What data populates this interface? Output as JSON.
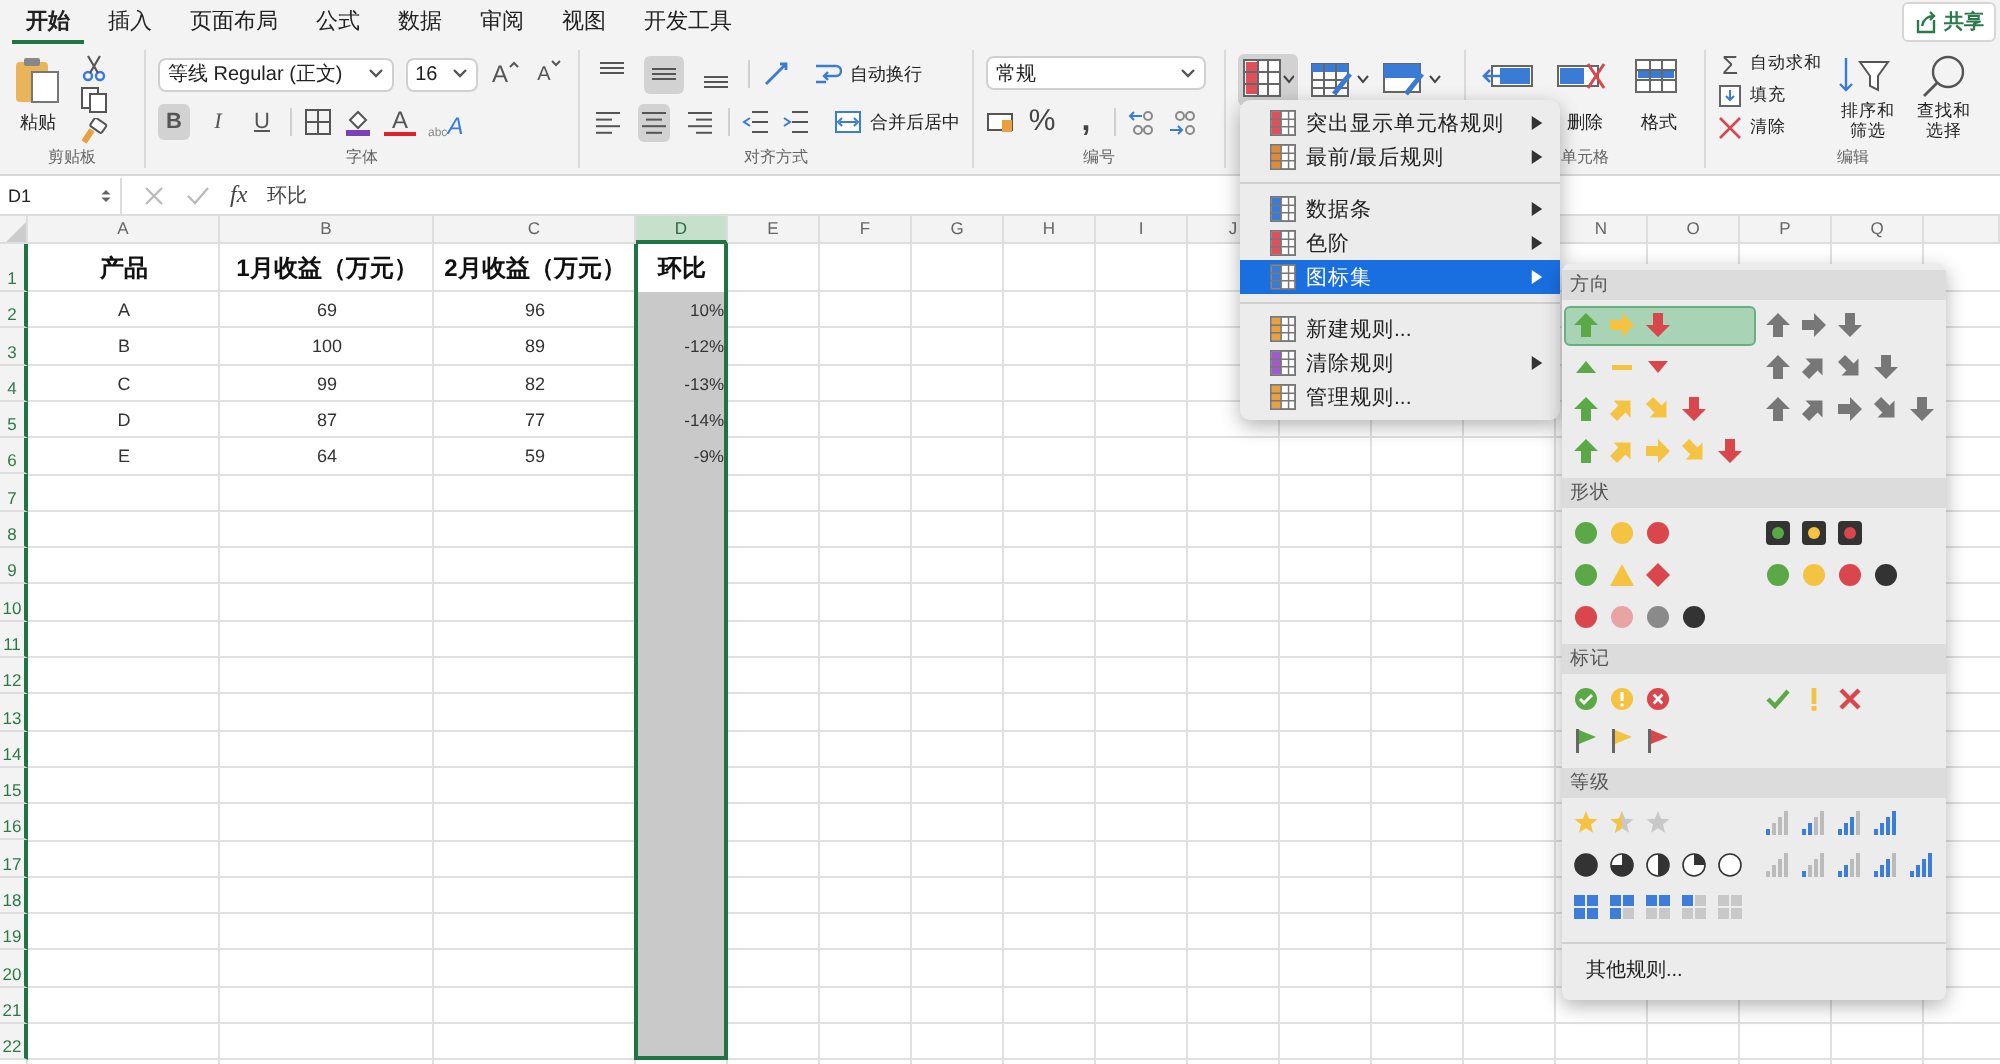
{
  "tabs": [
    {
      "label": "开始",
      "selected": true
    },
    {
      "label": "插入",
      "selected": false
    },
    {
      "label": "页面布局",
      "selected": false
    },
    {
      "label": "公式",
      "selected": false
    },
    {
      "label": "数据",
      "selected": false
    },
    {
      "label": "审阅",
      "selected": false
    },
    {
      "label": "视图",
      "selected": false
    },
    {
      "label": "开发工具",
      "selected": false
    }
  ],
  "share_button": "共享",
  "ribbon": {
    "clipboard": {
      "paste": "粘贴",
      "label": "剪贴板"
    },
    "font": {
      "name": "等线 Regular (正文)",
      "size": "16",
      "grow": "A",
      "shrink": "A",
      "styles": [
        {
          "label": "B",
          "selected": true
        },
        {
          "label": "I",
          "selected": false
        },
        {
          "label": "U",
          "selected": false
        }
      ],
      "font_color": "A",
      "effects_small": "abc",
      "effects_big": "A",
      "label": "字体"
    },
    "alignment": {
      "vertical": [
        {
          "kind": "top",
          "selected": false
        },
        {
          "kind": "middle",
          "selected": true
        },
        {
          "kind": "bottom",
          "selected": false
        }
      ],
      "horizontal": [
        {
          "kind": "left",
          "selected": false
        },
        {
          "kind": "center",
          "selected": true
        },
        {
          "kind": "right",
          "selected": false
        }
      ],
      "wrap": "自动换行",
      "merge": "合并后居中",
      "label": "对齐方式"
    },
    "number": {
      "format": "常规",
      "percent": "%",
      "comma": ",",
      "label": "编号"
    },
    "styles": {
      "conditional_expanded": true
    },
    "cells": {
      "items": [
        {
          "kind": "insert"
        },
        {
          "kind": "delete",
          "label": "删除"
        },
        {
          "kind": "format",
          "label": "格式"
        }
      ],
      "label": "单元格"
    },
    "editing": {
      "autosum_symbol": "Σ",
      "autosum": "自动求和",
      "fill": "填充",
      "clear": "清除",
      "sort": "排序和筛选",
      "find": "查找和选择",
      "label": "编辑"
    }
  },
  "formula_bar": {
    "name_box": "D1",
    "fx": "fx",
    "formula": "环比"
  },
  "sheet": {
    "columns": [
      {
        "label": "A",
        "selected": false
      },
      {
        "label": "B",
        "selected": false
      },
      {
        "label": "C",
        "selected": false
      },
      {
        "label": "D",
        "selected": true
      },
      {
        "label": "E",
        "selected": false
      },
      {
        "label": "F",
        "selected": false
      },
      {
        "label": "G",
        "selected": false
      },
      {
        "label": "H",
        "selected": false
      },
      {
        "label": "I",
        "selected": false
      },
      {
        "label": "J",
        "selected": false
      }
    ],
    "columns_right": [
      {
        "label": "N",
        "selected": false
      },
      {
        "label": "O",
        "selected": false
      },
      {
        "label": "P",
        "selected": false
      },
      {
        "label": "Q",
        "selected": false
      }
    ],
    "row_numbers": [
      "1",
      "2",
      "3",
      "4",
      "5",
      "6",
      "7",
      "8",
      "9",
      "10",
      "11",
      "12",
      "13",
      "14",
      "15",
      "16",
      "17",
      "18",
      "19",
      "20",
      "21",
      "22"
    ],
    "cells": [
      [
        "产品",
        "1月收益（万元）",
        "2月收益（万元）",
        "环比"
      ],
      [
        "A",
        "69",
        "96",
        "10%"
      ],
      [
        "B",
        "100",
        "89",
        "-12%"
      ],
      [
        "C",
        "99",
        "82",
        "-13%"
      ],
      [
        "D",
        "87",
        "77",
        "-14%"
      ],
      [
        "E",
        "64",
        "59",
        "-9%"
      ]
    ]
  },
  "menu": [
    [
      {
        "label": "突出显示单元格规则",
        "kind": "highlight",
        "submenu": true,
        "selected": false
      },
      {
        "label": "最前/最后规则",
        "kind": "topbottom",
        "submenu": true,
        "selected": false
      }
    ],
    [
      {
        "label": "数据条",
        "kind": "databar",
        "submenu": true,
        "selected": false
      },
      {
        "label": "色阶",
        "kind": "colorscale",
        "submenu": true,
        "selected": false
      },
      {
        "label": "图标集",
        "kind": "iconset",
        "submenu": true,
        "selected": true
      }
    ],
    [
      {
        "label": "新建规则...",
        "kind": "newrule",
        "submenu": false,
        "selected": false
      },
      {
        "label": "清除规则",
        "kind": "clear",
        "submenu": true,
        "selected": false
      },
      {
        "label": "管理规则...",
        "kind": "manage",
        "submenu": false,
        "selected": false
      }
    ]
  ],
  "icon_sets": {
    "sections": [
      {
        "title": "方向",
        "options": [
          {
            "kind": "arrows3",
            "selected": true
          },
          {
            "kind": "grayarrows3",
            "selected": false
          },
          {
            "kind": "triangles3",
            "selected": false
          },
          {
            "kind": "grayarrows4",
            "selected": false
          },
          {
            "kind": "arrows4",
            "selected": false
          },
          {
            "kind": "grayarrows5",
            "selected": false
          },
          {
            "kind": "arrows5",
            "selected": false
          }
        ]
      },
      {
        "title": "形状",
        "options": [
          {
            "kind": "trafficlights3",
            "selected": false
          },
          {
            "kind": "framedlights3",
            "selected": false
          },
          {
            "kind": "shapes3",
            "selected": false
          },
          {
            "kind": "lights4",
            "selected": false
          },
          {
            "kind": "redtoblack",
            "selected": false
          }
        ]
      },
      {
        "title": "标记",
        "options": [
          {
            "kind": "symbols3circled",
            "selected": false
          },
          {
            "kind": "symbols3",
            "selected": false
          },
          {
            "kind": "flags3",
            "selected": false
          }
        ]
      },
      {
        "title": "等级",
        "options": [
          {
            "kind": "stars3",
            "selected": false
          },
          {
            "kind": "signal4",
            "selected": false
          },
          {
            "kind": "quarters5",
            "selected": false
          },
          {
            "kind": "signal5",
            "selected": false
          },
          {
            "kind": "boxes5",
            "selected": false
          }
        ]
      }
    ],
    "more": "其他规则..."
  }
}
